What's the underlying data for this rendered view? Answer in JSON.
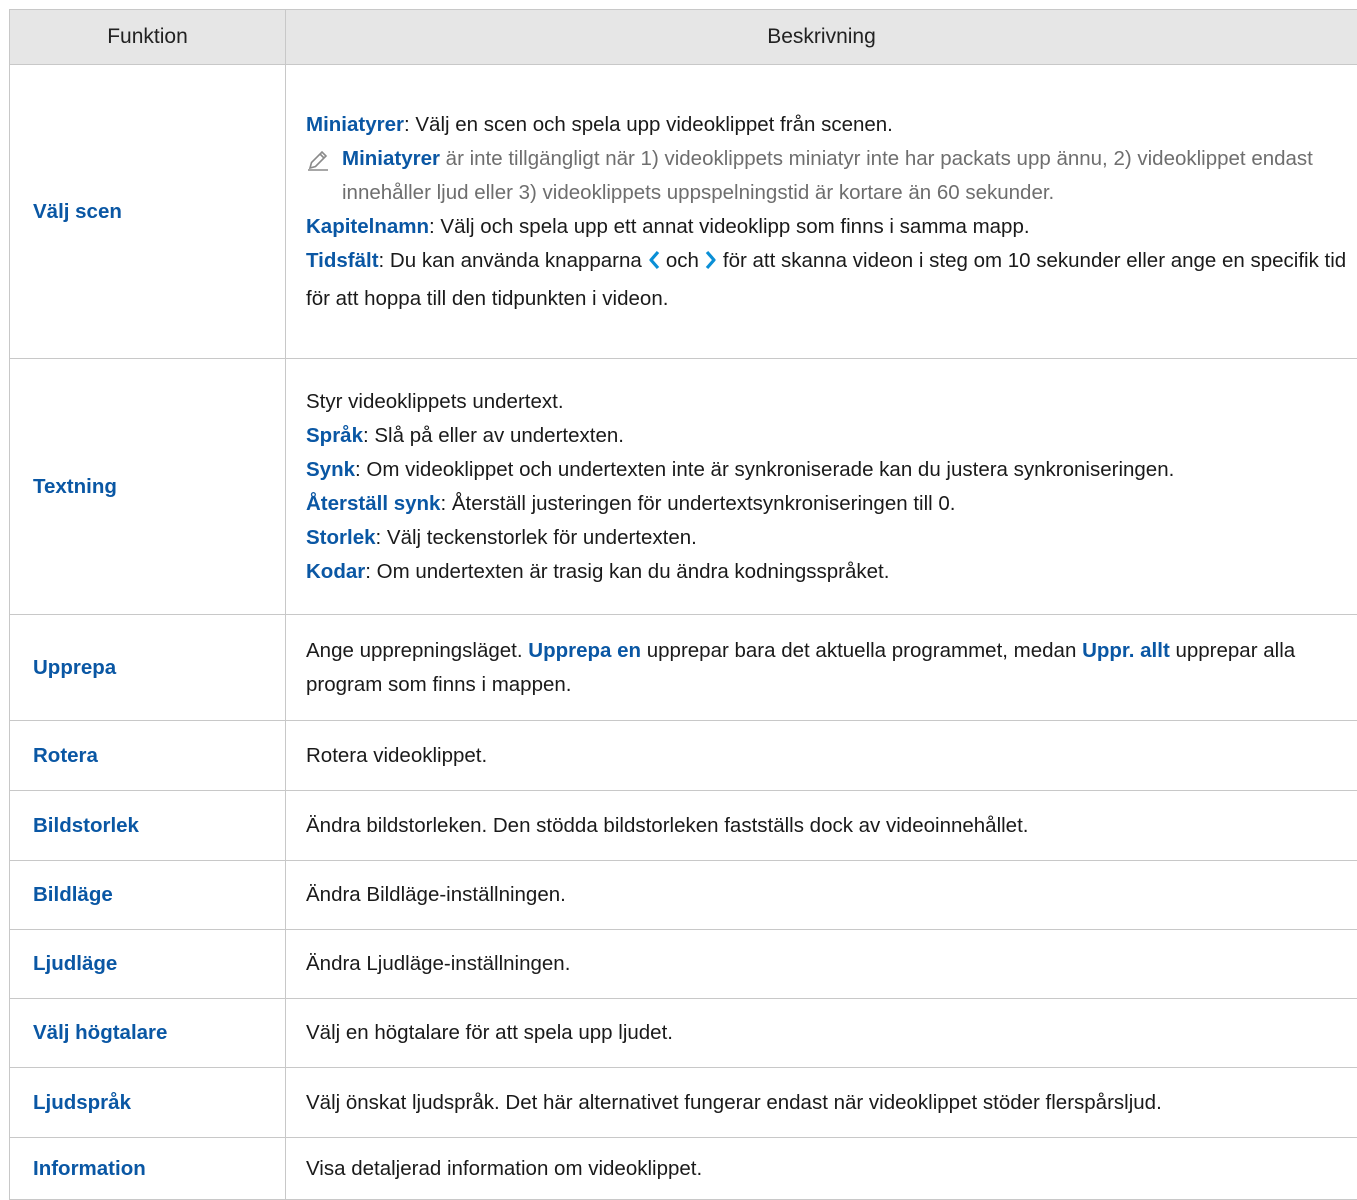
{
  "header": {
    "col_function": "Funktion",
    "col_description": "Beskrivning"
  },
  "rows": {
    "valj_scen": {
      "name": "Välj scen",
      "miniatyrer_kw": "Miniatyrer",
      "miniatyrer_text": ": Välj en scen och spela upp videoklippet från scenen.",
      "note_kw": "Miniatyrer",
      "note_text": " är inte tillgängligt när 1) videoklippets miniatyr inte har packats upp ännu, 2) videoklippet endast innehåller ljud eller 3) videoklippets uppspelningstid är kortare än 60 sekunder.",
      "kapitel_kw": "Kapitelnamn",
      "kapitel_text": ": Välj och spela upp ett annat videoklipp som finns i samma mapp.",
      "tidsfalt_kw": "Tidsfält",
      "tidsfalt_text_a": ": Du kan använda knapparna",
      "tidsfalt_text_b": "och",
      "tidsfalt_text_c": "för att skanna videon i steg om 10 sekunder eller ange en specifik tid för att hoppa till den tidpunkten i videon."
    },
    "textning": {
      "name": "Textning",
      "intro": "Styr videoklippets undertext.",
      "sprak_kw": "Språk",
      "sprak_text": ": Slå på eller av undertexten.",
      "synk_kw": "Synk",
      "synk_text": ": Om videoklippet och undertexten inte är synkroniserade kan du justera synkroniseringen.",
      "aterstall_kw": "Återställ synk",
      "aterstall_text": ": Återställ justeringen för undertextsynkroniseringen till 0.",
      "storlek_kw": "Storlek",
      "storlek_text": ": Välj teckenstorlek för undertexten.",
      "kodar_kw": "Kodar",
      "kodar_text": ": Om undertexten är trasig kan du ändra kodningsspråket."
    },
    "upprepa": {
      "name": "Upprepa",
      "text_a": "Ange upprepningsläget. ",
      "kw_a": "Upprepa en",
      "text_b": " upprepar bara det aktuella programmet, medan ",
      "kw_b": "Uppr. allt",
      "text_c": " upprepar alla program som finns i mappen."
    },
    "rotera": {
      "name": "Rotera",
      "desc": "Rotera videoklippet."
    },
    "bildstorlek": {
      "name": "Bildstorlek",
      "desc": "Ändra bildstorleken. Den stödda bildstorleken fastställs dock av videoinnehållet."
    },
    "bildlage": {
      "name": "Bildläge",
      "desc": "Ändra Bildläge-inställningen."
    },
    "ljudlage": {
      "name": "Ljudläge",
      "desc": "Ändra Ljudläge-inställningen."
    },
    "valj_hogtalare": {
      "name": "Välj högtalare",
      "desc": "Välj en högtalare för att spela upp ljudet."
    },
    "ljudsprak": {
      "name": "Ljudspråk",
      "desc": "Välj önskat ljudspråk. Det här alternativet fungerar endast när videoklippet stöder flerspårsljud."
    },
    "information": {
      "name": "Information",
      "desc": "Visa detaljerad information om videoklippet."
    }
  },
  "colors": {
    "keyword": "#0a57a4",
    "header_bg": "#e6e6e6",
    "note_text": "#6e6e6e",
    "border": "#c8c8c8"
  },
  "icons": {
    "note": "pencil-icon",
    "left": "chevron-left-icon",
    "right": "chevron-right-icon"
  }
}
